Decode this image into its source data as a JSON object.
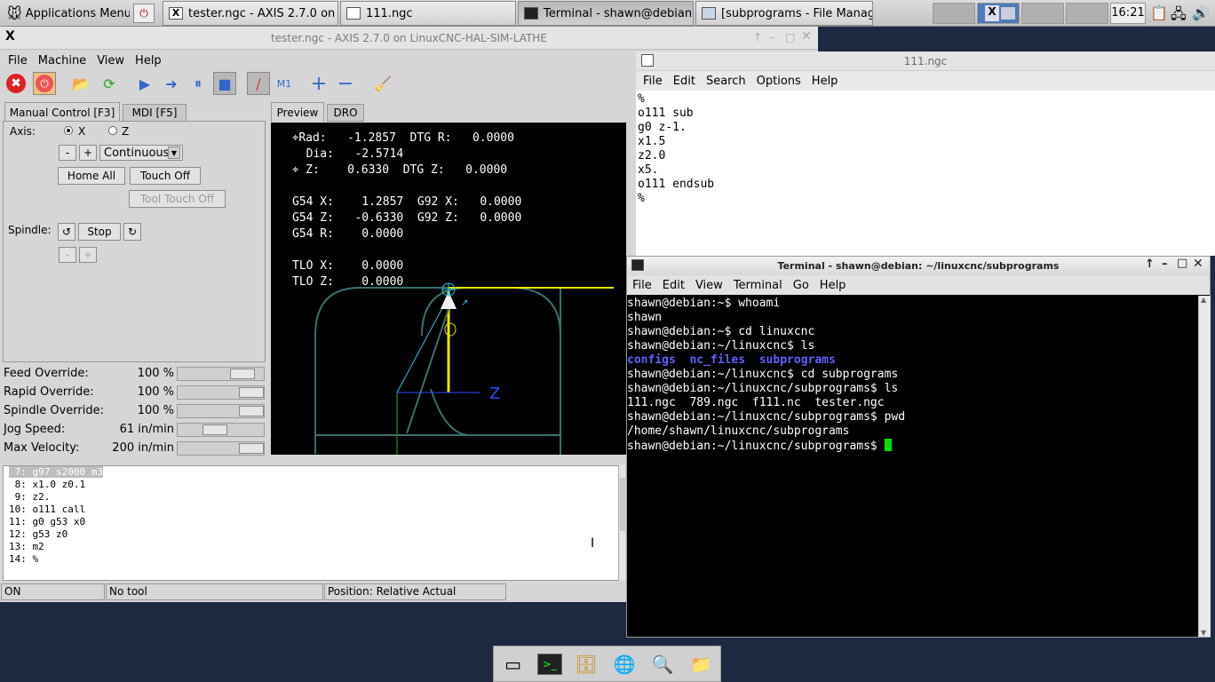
{
  "panel": {
    "apps_menu": "Applications Menu",
    "tasks": [
      {
        "label": "tester.ngc - AXIS 2.7.0 on ..."
      },
      {
        "label": "111.ngc"
      },
      {
        "label": "Terminal - shawn@debian:..."
      },
      {
        "label": "[subprograms - File Manag..."
      }
    ],
    "clock": "16:21"
  },
  "axis": {
    "title": "tester.ngc - AXIS 2.7.0 on LinuxCNC-HAL-SIM-LATHE",
    "menu": [
      "File",
      "Machine",
      "View",
      "Help"
    ],
    "tabs_left": [
      "Manual Control [F3]",
      "MDI [F5]"
    ],
    "tabs_right": [
      "Preview",
      "DRO"
    ],
    "axis_label": "Axis:",
    "axis_x": "X",
    "axis_z": "Z",
    "minus": "-",
    "plus": "+",
    "jog_mode": "Continuous",
    "home_all": "Home All",
    "touch_off": "Touch Off",
    "tool_touch_off": "Tool Touch Off",
    "spindle_label": "Spindle:",
    "spindle_stop": "Stop",
    "overrides": [
      {
        "label": "Feed Override:",
        "value": "100 %",
        "level": 0.85
      },
      {
        "label": "Rapid Override:",
        "value": "100 %",
        "level": 1.0
      },
      {
        "label": "Spindle Override:",
        "value": "100 %",
        "level": 1.0
      },
      {
        "label": "Jog Speed:",
        "value": "61 in/min",
        "level": 0.4
      },
      {
        "label": "Max Velocity:",
        "value": "200 in/min",
        "level": 1.0
      }
    ],
    "dro": [
      "⌖Rad:   -1.2857  DTG R:   0.0000",
      "  Dia:   -2.5714",
      "⌖ Z:    0.6330  DTG Z:   0.0000",
      "",
      "G54 X:    1.2857  G92 X:   0.0000",
      "G54 Z:   -0.6330  G92 Z:   0.0000",
      "G54 R:    0.0000",
      "",
      "TLO X:    0.0000",
      "TLO Z:    0.0000"
    ],
    "z_label": "Z",
    "gcode": [
      " 7: g97 s2000 m3",
      " 8: x1.0 z0.1",
      " 9: z2.",
      "10: o111 call",
      "11: g0 g53 x0",
      "12: g53 z0",
      "13: m2",
      "14: %"
    ],
    "status": [
      "ON",
      "No tool",
      "Position: Relative Actual"
    ]
  },
  "editor": {
    "title": "111.ngc",
    "menu": [
      "File",
      "Edit",
      "Search",
      "Options",
      "Help"
    ],
    "lines": [
      "%",
      "o111 sub",
      "g0 z-1.",
      "x1.5",
      "z2.0",
      "x5.",
      "o111 endsub",
      "%"
    ]
  },
  "terminal": {
    "title": "Terminal - shawn@debian: ~/linuxcnc/subprograms",
    "menu": [
      "File",
      "Edit",
      "View",
      "Terminal",
      "Go",
      "Help"
    ],
    "lines": [
      "shawn@debian:~$ whoami",
      "shawn",
      "shawn@debian:~$ cd linuxcnc",
      "shawn@debian:~/linuxcnc$ ls",
      "",
      "shawn@debian:~/linuxcnc$ cd subprograms",
      "shawn@debian:~/linuxcnc/subprograms$ ls",
      "111.ngc  789.ngc  f111.nc  tester.ngc",
      "shawn@debian:~/linuxcnc/subprograms$ pwd",
      "/home/shawn/linuxcnc/subprograms",
      "shawn@debian:~/linuxcnc/subprograms$ "
    ],
    "dirs": [
      "configs",
      "nc_files",
      "subprograms"
    ],
    "dir_color": "#6060ff",
    "cursor_color": "#00e000"
  }
}
